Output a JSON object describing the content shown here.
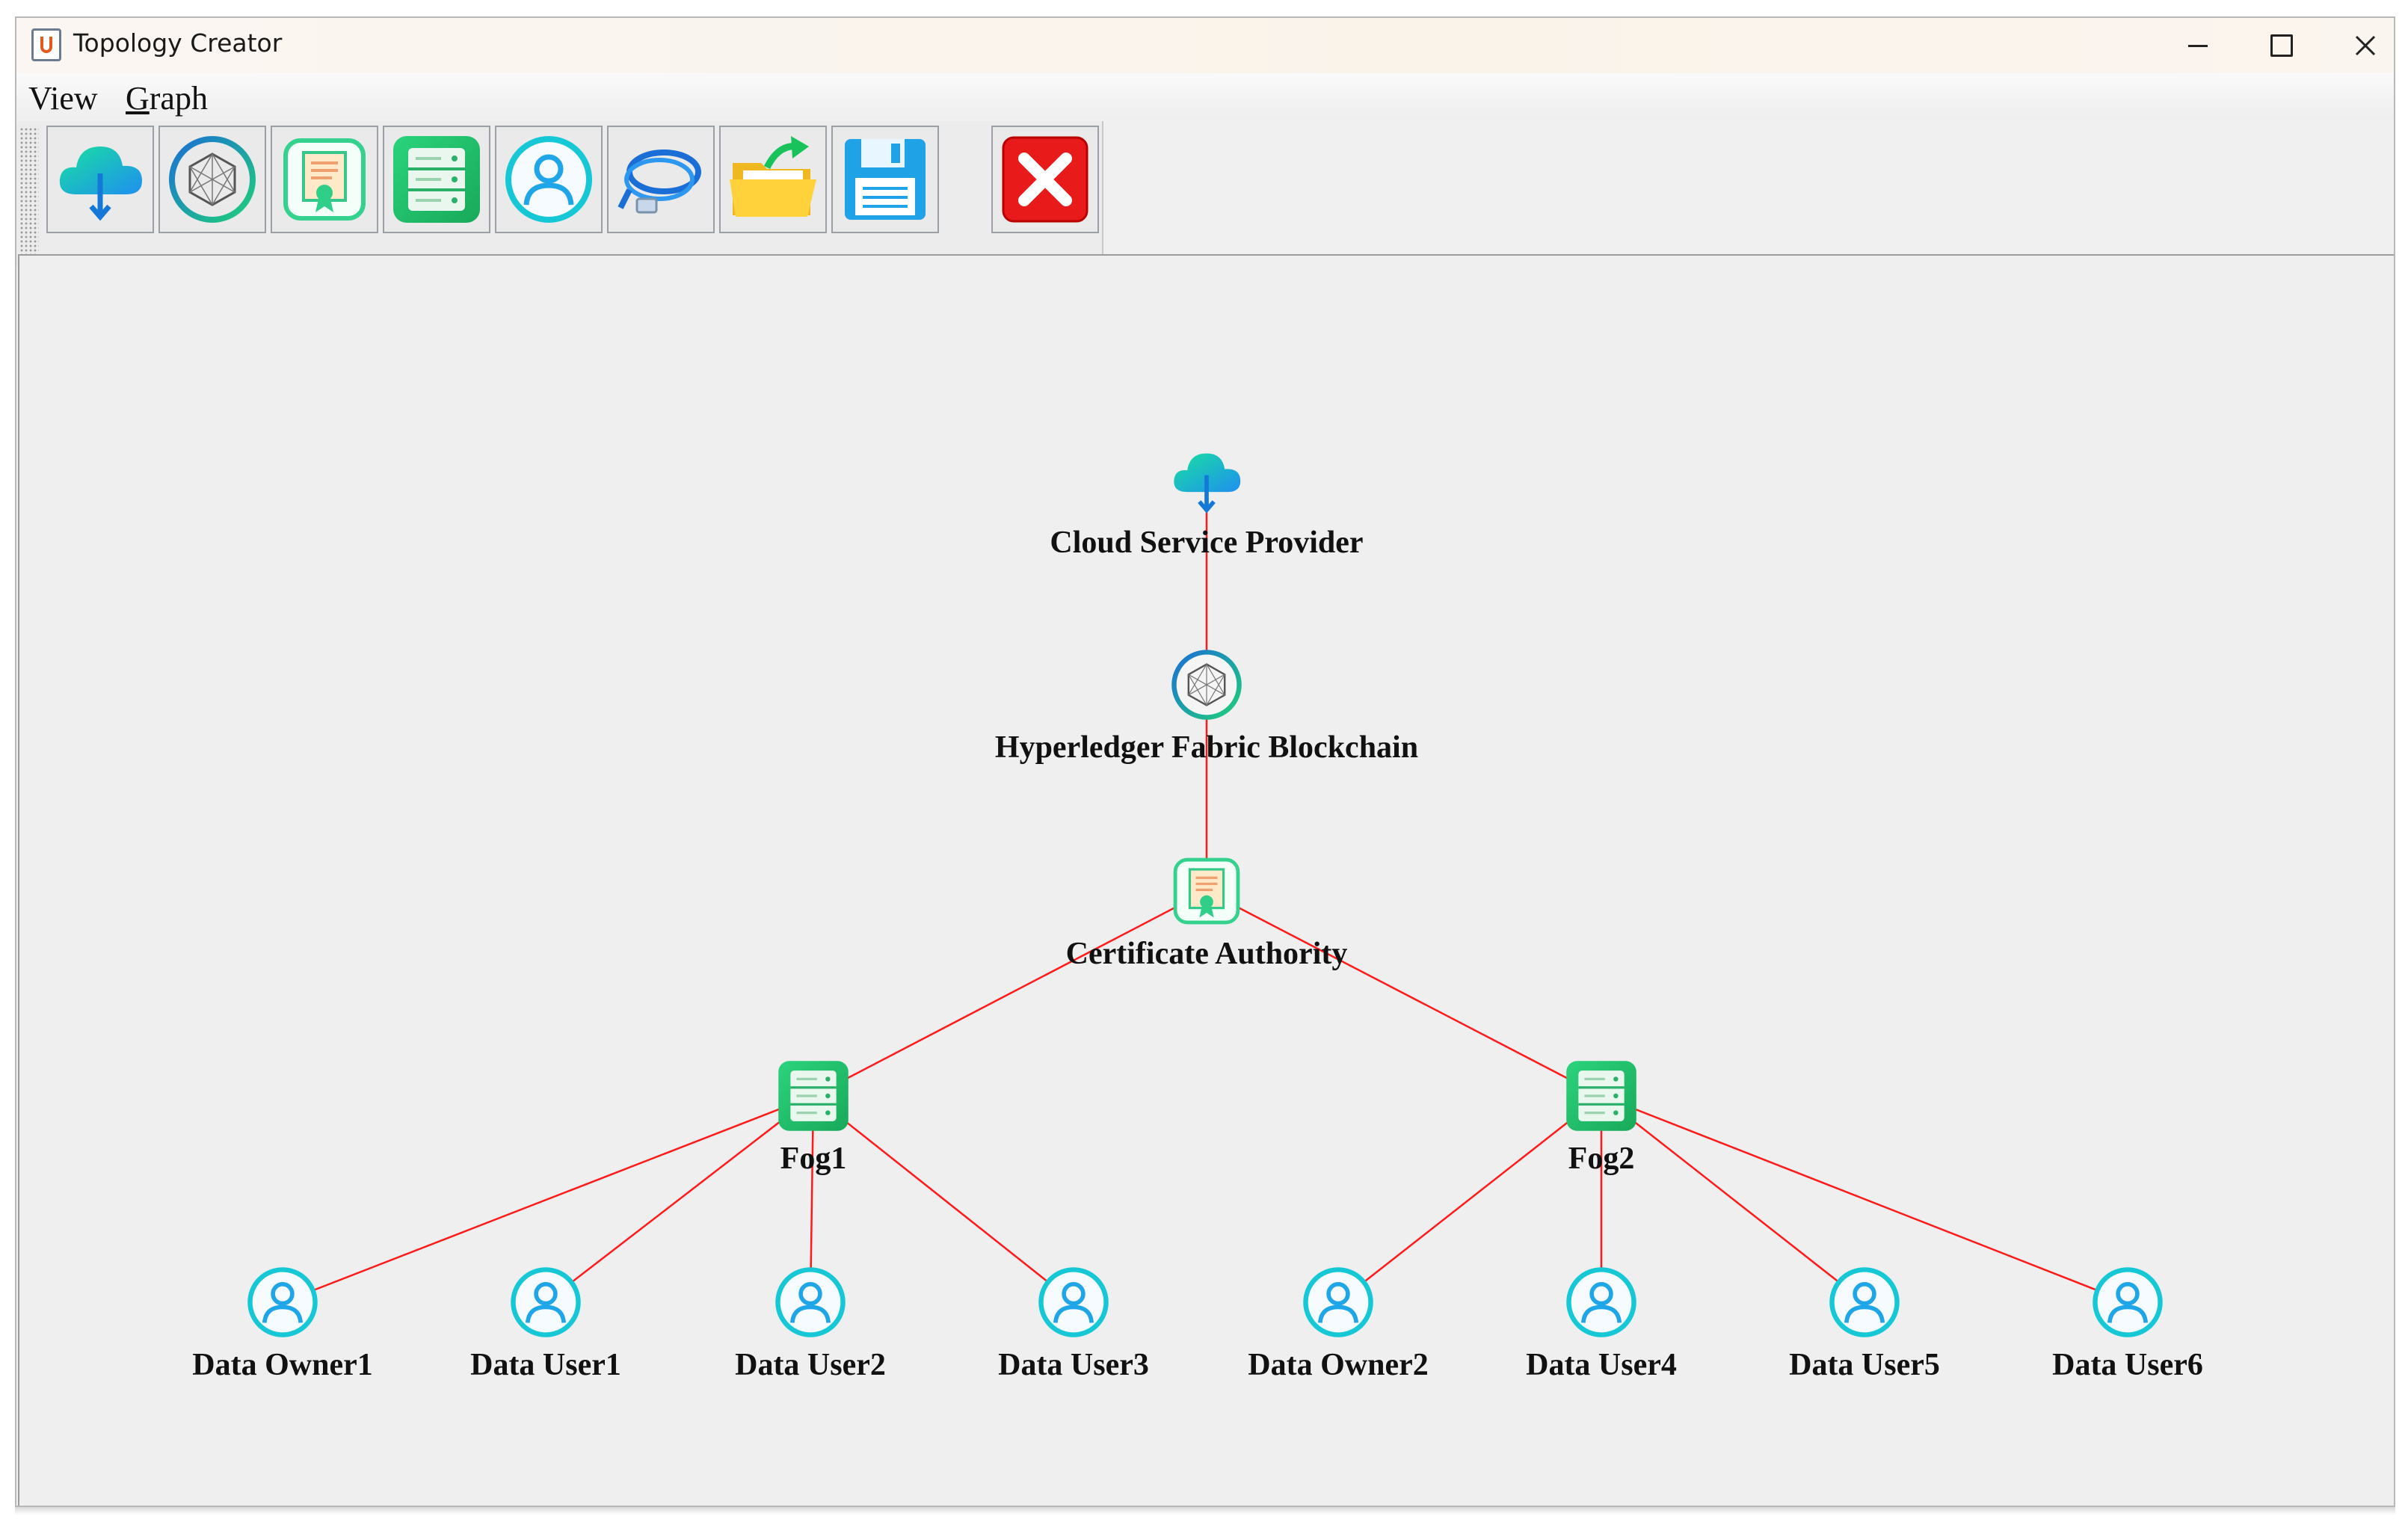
{
  "window": {
    "title": "Topology Creator",
    "controls": [
      "minimize",
      "maximize",
      "close"
    ]
  },
  "menu": {
    "items": [
      "View",
      "Graph"
    ]
  },
  "toolbar": {
    "buttons": [
      {
        "icon": "cloud-upload-icon"
      },
      {
        "icon": "blockchain-network-icon"
      },
      {
        "icon": "certificate-icon"
      },
      {
        "icon": "server-icon"
      },
      {
        "icon": "user-icon"
      },
      {
        "icon": "cable-icon"
      },
      {
        "icon": "open-folder-icon"
      },
      {
        "icon": "save-floppy-icon"
      },
      {
        "icon": "exit-icon"
      }
    ]
  },
  "topology": {
    "edge_color": "#ff1a1a",
    "nodes": [
      {
        "id": "csp",
        "label": "Cloud Service Provider",
        "type": "cloud"
      },
      {
        "id": "hfb",
        "label": "Hyperledger Fabric Blockchain",
        "type": "blockchain"
      },
      {
        "id": "ca",
        "label": "Certificate Authority",
        "type": "certificate"
      },
      {
        "id": "fog1",
        "label": "Fog1",
        "type": "fog"
      },
      {
        "id": "fog2",
        "label": "Fog2",
        "type": "fog"
      },
      {
        "id": "do1",
        "label": "Data Owner1",
        "type": "user"
      },
      {
        "id": "du1",
        "label": "Data User1",
        "type": "user"
      },
      {
        "id": "du2",
        "label": "Data User2",
        "type": "user"
      },
      {
        "id": "du3",
        "label": "Data User3",
        "type": "user"
      },
      {
        "id": "do2",
        "label": "Data Owner2",
        "type": "user"
      },
      {
        "id": "du4",
        "label": "Data User4",
        "type": "user"
      },
      {
        "id": "du5",
        "label": "Data User5",
        "type": "user"
      },
      {
        "id": "du6",
        "label": "Data User6",
        "type": "user"
      }
    ],
    "edges": [
      [
        "csp",
        "ca"
      ],
      [
        "ca",
        "fog1"
      ],
      [
        "ca",
        "fog2"
      ],
      [
        "fog1",
        "do1"
      ],
      [
        "fog1",
        "du1"
      ],
      [
        "fog1",
        "du2"
      ],
      [
        "fog1",
        "du3"
      ],
      [
        "fog2",
        "do2"
      ],
      [
        "fog2",
        "du4"
      ],
      [
        "fog2",
        "du5"
      ],
      [
        "fog2",
        "du6"
      ]
    ]
  }
}
